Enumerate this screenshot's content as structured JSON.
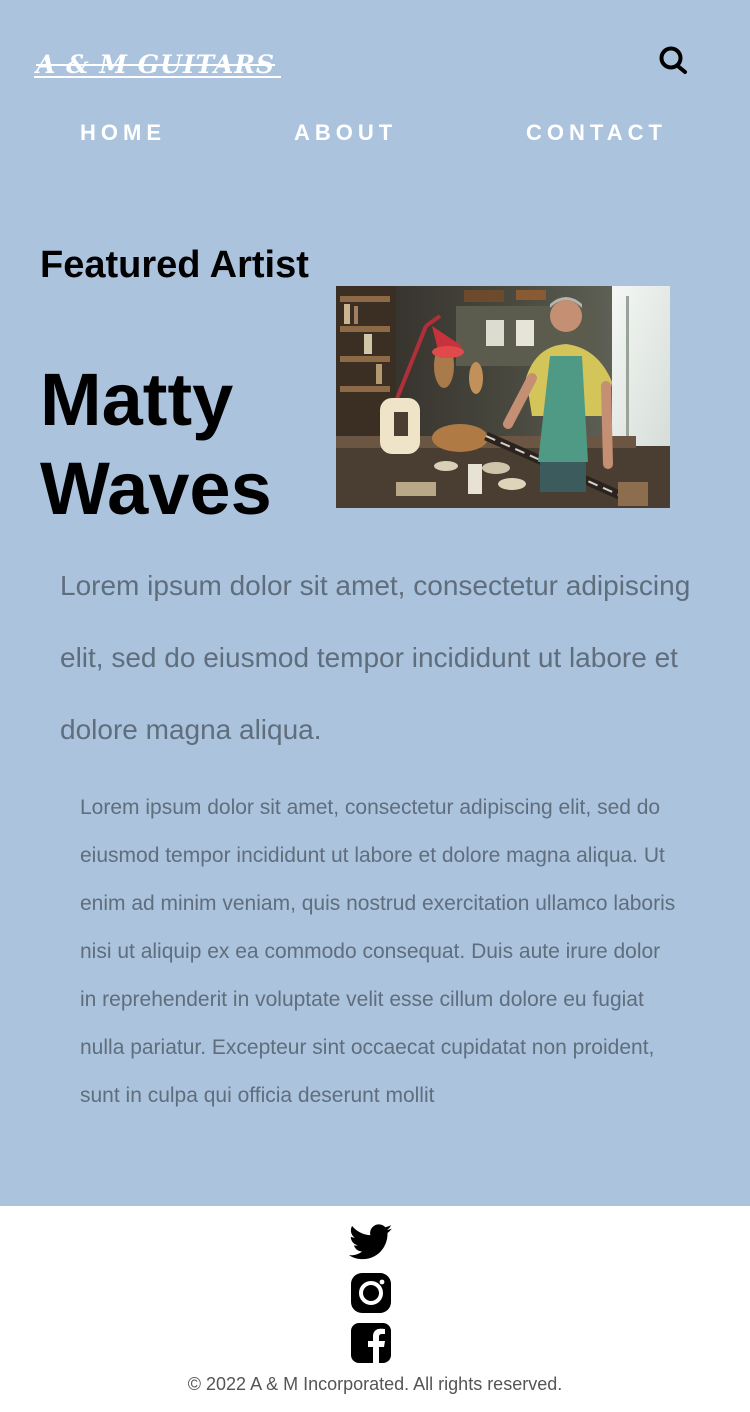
{
  "brand": {
    "logo_text": "A & M GUITARS"
  },
  "nav": {
    "items": [
      {
        "label": "HOME"
      },
      {
        "label": "ABOUT"
      },
      {
        "label": "CONTACT"
      }
    ]
  },
  "featured": {
    "section_label": "Featured Artist",
    "artist_name": "Matty Waves",
    "photo_alt": "Luthier working on a guitar in a workshop"
  },
  "content": {
    "intro": "Lorem ipsum dolor sit amet, consectetur adipiscing elit, sed do eiusmod tempor incididunt ut labore et dolore magna aliqua.",
    "body": "Lorem ipsum dolor sit amet, consectetur adipiscing elit, sed do eiusmod tempor incididunt ut labore et dolore magna aliqua. Ut enim ad minim veniam, quis nostrud exercitation ullamco laboris nisi ut aliquip ex ea commodo consequat. Duis aute irure dolor in reprehenderit in voluptate velit esse cillum dolore eu fugiat nulla pariatur. Excepteur sint occaecat cupidatat non proident, sunt in culpa qui officia deserunt mollit"
  },
  "footer": {
    "social": [
      {
        "icon": "twitter-icon"
      },
      {
        "icon": "instagram-icon"
      },
      {
        "icon": "facebook-icon"
      }
    ],
    "copyright": "© 2022 A & M Incorporated. All rights reserved."
  },
  "colors": {
    "main_background": "#abc3dd",
    "nav_text": "#ffffff",
    "heading_text": "#000000",
    "body_text": "#5f6e7d",
    "footer_background": "#ffffff"
  }
}
